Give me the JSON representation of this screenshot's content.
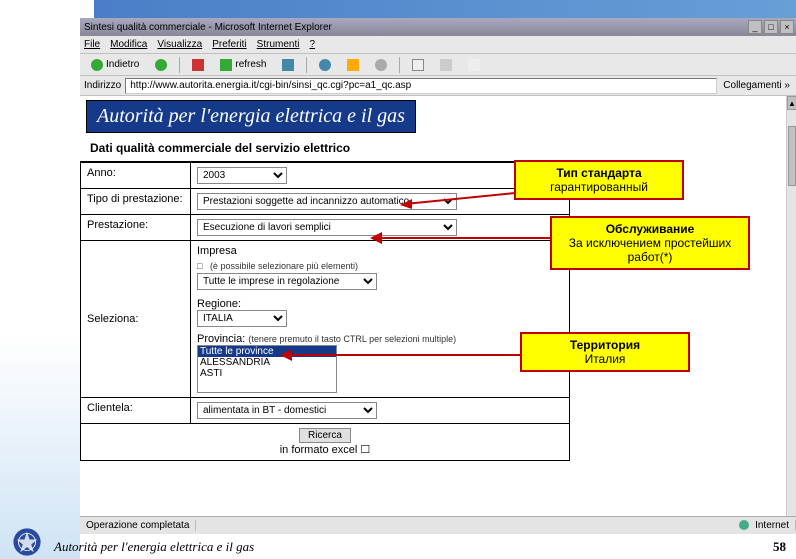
{
  "window": {
    "title": "Sintesi qualità commerciale - Microsoft Internet Explorer",
    "min": "_",
    "max": "□",
    "close": "×"
  },
  "menu": {
    "file": "File",
    "modifica": "Modifica",
    "visualizza": "Visualizza",
    "preferiti": "Preferiti",
    "strumenti": "Strumenti",
    "help": "?"
  },
  "toolbar": {
    "back": "Indietro",
    "refresh": "refresh"
  },
  "address": {
    "label": "Indirizzo",
    "url": "http://www.autorita.energia.it/cgi-bin/sinsi_qc.cgi?pc=a1_qc.asp",
    "go": "Collegamenti »"
  },
  "page": {
    "title": "Autorità per l'energia elettrica e il gas",
    "section": "Dati qualità commerciale del servizio elettrico"
  },
  "form": {
    "anno_label": "Anno:",
    "anno_value": "2003",
    "tipo_label": "Tipo di prestazione:",
    "tipo_value": "Prestazioni soggette ad incannizzo automatico",
    "prestazione_label": "Prestazione:",
    "prestazione_value": "Esecuzione di lavori semplici",
    "seleziona_label": "Seleziona:",
    "impresa_label": "Impresa",
    "impresa_note": "(è possibile selezionare più elementi)",
    "impresa_value": "Tutte le imprese in regolazione",
    "regione_label": "Regione:",
    "regione_value": "ITALIA",
    "provincia_label": "Provincia:",
    "provincia_note": "(tenere premuto il tasto CTRL per selezioni multiple)",
    "province_all": "Tutte le province",
    "province_1": "ALESSANDRIA",
    "province_2": "ASTI",
    "clientela_label": "Clientela:",
    "clientela_value": "alimentata in BT - domestici",
    "submit": "Ricerca",
    "excel": "in formato excel",
    "checkbox": "☐"
  },
  "callouts": {
    "c1_title": "Тип стандарта",
    "c1_sub": "гарантированный",
    "c2_title": "Обслуживание",
    "c2_sub": "За исключением простейших работ(*)",
    "c3_title": "Территория",
    "c3_sub": "Италия"
  },
  "status": {
    "text": "Operazione completata",
    "zone": "Internet"
  },
  "slide": {
    "footer": "Autorità per l'energia elettrica e il gas",
    "page": "58"
  }
}
